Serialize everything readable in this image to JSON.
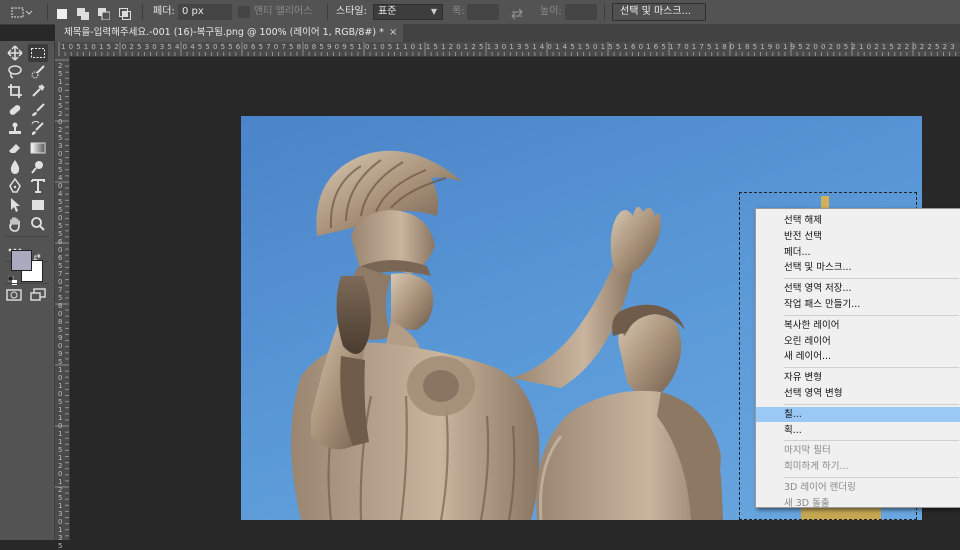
{
  "options_bar": {
    "feather_label": "페더:",
    "feather_value": "0 px",
    "antialias_label": "앤티 앨리어스",
    "style_label": "스타일:",
    "style_value": "표준",
    "width_label": "폭:",
    "height_label": "높이:",
    "select_mask_button": "선택 및 마스크..."
  },
  "document_tab": {
    "title": "제목을-입력해주세요.-001 (16)-복구됨.png @ 100% (레이어 1, RGB/8#) *",
    "close": "×"
  },
  "ruler": {
    "top_labels": [
      "1",
      "0",
      "5",
      "1",
      "0",
      "1",
      "5",
      "2",
      "0",
      "2",
      "5",
      "3",
      "0",
      "3",
      "5",
      "4",
      "0",
      "4",
      "5",
      "5",
      "0",
      "5",
      "5",
      "6",
      "0",
      "6",
      "5",
      "7",
      "0",
      "7",
      "5",
      "8",
      "0",
      "8",
      "5",
      "9",
      "0",
      "9",
      "5",
      "1",
      "0",
      "1",
      "0",
      "5",
      "1",
      "1",
      "0",
      "1",
      "1",
      "5",
      "1",
      "2",
      "0",
      "1",
      "2",
      "5",
      "1",
      "3",
      "0",
      "1",
      "3",
      "5",
      "1",
      "4",
      "0",
      "1",
      "4",
      "5",
      "1",
      "5",
      "0",
      "1",
      "5",
      "5",
      "1",
      "6",
      "0",
      "1",
      "6",
      "5",
      "1",
      "7",
      "0",
      "1",
      "7",
      "5",
      "1",
      "8",
      "0",
      "1",
      "8",
      "5",
      "1",
      "9",
      "0",
      "1",
      "9",
      "5",
      "2",
      "0",
      "0",
      "2",
      "0",
      "5",
      "2",
      "1",
      "0",
      "2",
      "1",
      "5",
      "2",
      "2",
      "0",
      "2",
      "2",
      "5",
      "2",
      "3"
    ],
    "left_labels": [
      "2",
      "5",
      "1",
      "0",
      "1",
      "5",
      "2",
      "0",
      "2",
      "5",
      "3",
      "0",
      "3",
      "5",
      "4",
      "0",
      "4",
      "5",
      "5",
      "0",
      "5",
      "5",
      "6",
      "0",
      "6",
      "5",
      "7",
      "0",
      "7",
      "5",
      "8",
      "0",
      "8",
      "5",
      "9",
      "0",
      "9",
      "5",
      "1",
      "0",
      "1",
      "0",
      "5",
      "1",
      "1",
      "0",
      "1",
      "1",
      "5",
      "1",
      "2",
      "0",
      "1",
      "2",
      "5",
      "1",
      "3",
      "0",
      "1",
      "3",
      "5"
    ]
  },
  "context_menu": {
    "items": [
      {
        "label": "선택 해제",
        "disabled": false,
        "highlight": false
      },
      {
        "label": "반전 선택",
        "disabled": false,
        "highlight": false
      },
      {
        "label": "페더...",
        "disabled": false,
        "highlight": false
      },
      {
        "label": "선택 및 마스크...",
        "disabled": false,
        "highlight": false
      },
      {
        "label": "선택 영역 저장...",
        "disabled": false,
        "highlight": false
      },
      {
        "label": "작업 패스 만들기...",
        "disabled": false,
        "highlight": false
      },
      {
        "label": "복사한 레이어",
        "disabled": false,
        "highlight": false
      },
      {
        "label": "오린 레이어",
        "disabled": false,
        "highlight": false
      },
      {
        "label": "새 레이어...",
        "disabled": false,
        "highlight": false
      },
      {
        "label": "자유 변형",
        "disabled": false,
        "highlight": false
      },
      {
        "label": "선택 영역 변형",
        "disabled": false,
        "highlight": false
      },
      {
        "label": "칠...",
        "disabled": false,
        "highlight": true
      },
      {
        "label": "획...",
        "disabled": false,
        "highlight": false
      },
      {
        "label": "마지막 필터",
        "disabled": true,
        "highlight": false
      },
      {
        "label": "희미하게 하기...",
        "disabled": true,
        "highlight": false
      },
      {
        "label": "3D 레이어 렌더링",
        "disabled": true,
        "highlight": false
      },
      {
        "label": "새 3D 돌출",
        "disabled": true,
        "highlight": false
      }
    ]
  },
  "colors": {
    "foreground": "#a9a9bf",
    "background": "#ffffff",
    "menu_highlight": "#99c9f4",
    "sky": "#5b9ad8"
  },
  "tools": [
    "move-icon",
    "rect-marquee-icon",
    "lasso-icon",
    "quick-select-icon",
    "crop-icon",
    "eyedropper-icon",
    "healing-brush-icon",
    "brush-icon",
    "stamp-icon",
    "history-brush-icon",
    "eraser-icon",
    "gradient-icon",
    "blur-icon",
    "dodge-icon",
    "pen-icon",
    "type-icon",
    "path-select-icon",
    "rectangle-shape-icon",
    "hand-icon",
    "zoom-icon",
    "more-tools-icon",
    "quick-mask-icon",
    "screen-mode-icon"
  ]
}
